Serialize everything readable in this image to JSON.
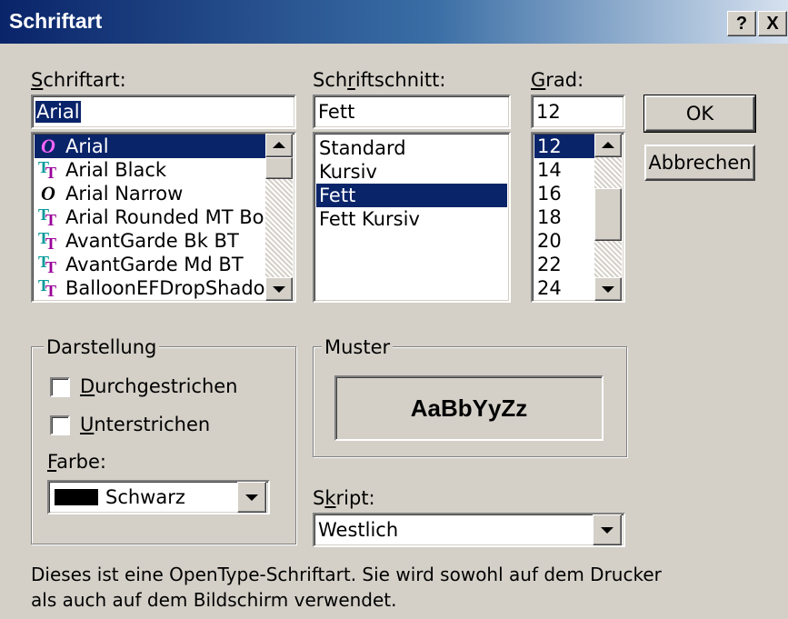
{
  "window": {
    "title": "Schriftart",
    "help_label": "?",
    "close_label": "X"
  },
  "font": {
    "label": "Schriftart:",
    "value": "Arial",
    "items": [
      {
        "name": "Arial",
        "icon": "opentype-icon",
        "selected": true
      },
      {
        "name": "Arial Black",
        "icon": "truetype-icon",
        "selected": false
      },
      {
        "name": "Arial Narrow",
        "icon": "opentype-icon",
        "selected": false
      },
      {
        "name": "Arial Rounded MT Bold",
        "icon": "truetype-icon",
        "selected": false
      },
      {
        "name": "AvantGarde Bk BT",
        "icon": "truetype-icon",
        "selected": false
      },
      {
        "name": "AvantGarde Md BT",
        "icon": "truetype-icon",
        "selected": false
      },
      {
        "name": "BalloonEFDropShadow",
        "icon": "truetype-icon",
        "selected": false
      }
    ]
  },
  "style": {
    "label": "Schriftschnitt:",
    "value": "Fett",
    "items": [
      {
        "name": "Standard",
        "selected": false
      },
      {
        "name": "Kursiv",
        "selected": false
      },
      {
        "name": "Fett",
        "selected": true
      },
      {
        "name": "Fett Kursiv",
        "selected": false
      }
    ]
  },
  "size": {
    "label": "Grad:",
    "value": "12",
    "items": [
      {
        "name": "12",
        "selected": true
      },
      {
        "name": "14",
        "selected": false
      },
      {
        "name": "16",
        "selected": false
      },
      {
        "name": "18",
        "selected": false
      },
      {
        "name": "20",
        "selected": false
      },
      {
        "name": "22",
        "selected": false
      },
      {
        "name": "24",
        "selected": false
      }
    ]
  },
  "buttons": {
    "ok": "OK",
    "cancel": "Abbrechen"
  },
  "effects": {
    "legend": "Darstellung",
    "strikeout": "Durchgestrichen",
    "underline": "Unterstrichen",
    "color_label": "Farbe:",
    "color_value": "Schwarz",
    "color_swatch": "#000000"
  },
  "sample": {
    "legend": "Muster",
    "text": "AaBbYyZz"
  },
  "script": {
    "label": "Skript:",
    "value": "Westlich"
  },
  "info": {
    "line1": "Dieses ist eine OpenType-Schriftart. Sie wird sowohl auf dem Drucker",
    "line2": "als auch auf dem Bildschirm verwendet."
  },
  "colors": {
    "selection": "#0a246a",
    "face": "#d4d0c8",
    "truetype": "#009999",
    "opentype": "#990099"
  }
}
